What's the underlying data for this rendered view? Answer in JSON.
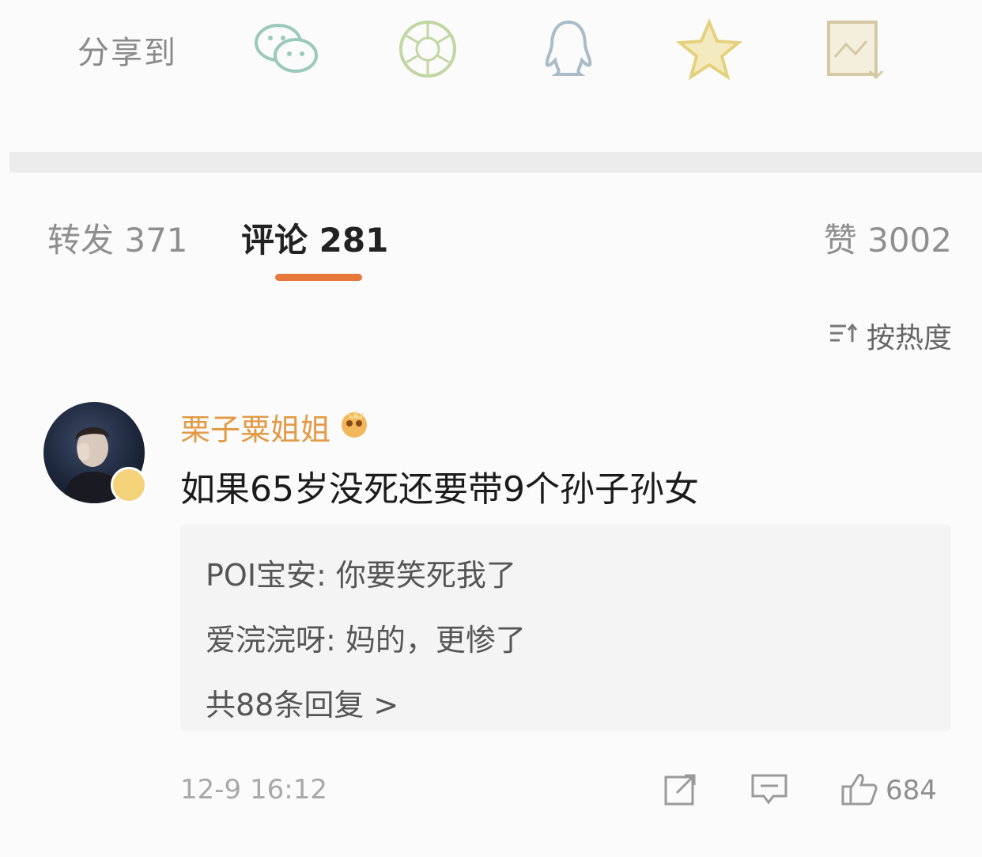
{
  "share": {
    "label": "分享到",
    "icons": [
      "wechat-icon",
      "moments-icon",
      "qq-icon",
      "qzone-icon",
      "save-image-icon"
    ]
  },
  "tabs": {
    "repost": "转发 371",
    "comments": "评论 281",
    "likes": "赞 3002"
  },
  "sort": {
    "label": "按热度"
  },
  "comment": {
    "username": "栗子粟姐姐",
    "text": "如果65岁没死还要带9个孙子孙女",
    "replies": [
      "POI宝安: 你要笑死我了",
      "爱浣浣呀: 妈的，更惨了"
    ],
    "more_replies": "共88条回复 >",
    "time": "12-9 16:12",
    "like_count": "684"
  },
  "colors": {
    "accent": "#e8773a",
    "username": "#e29a45"
  }
}
